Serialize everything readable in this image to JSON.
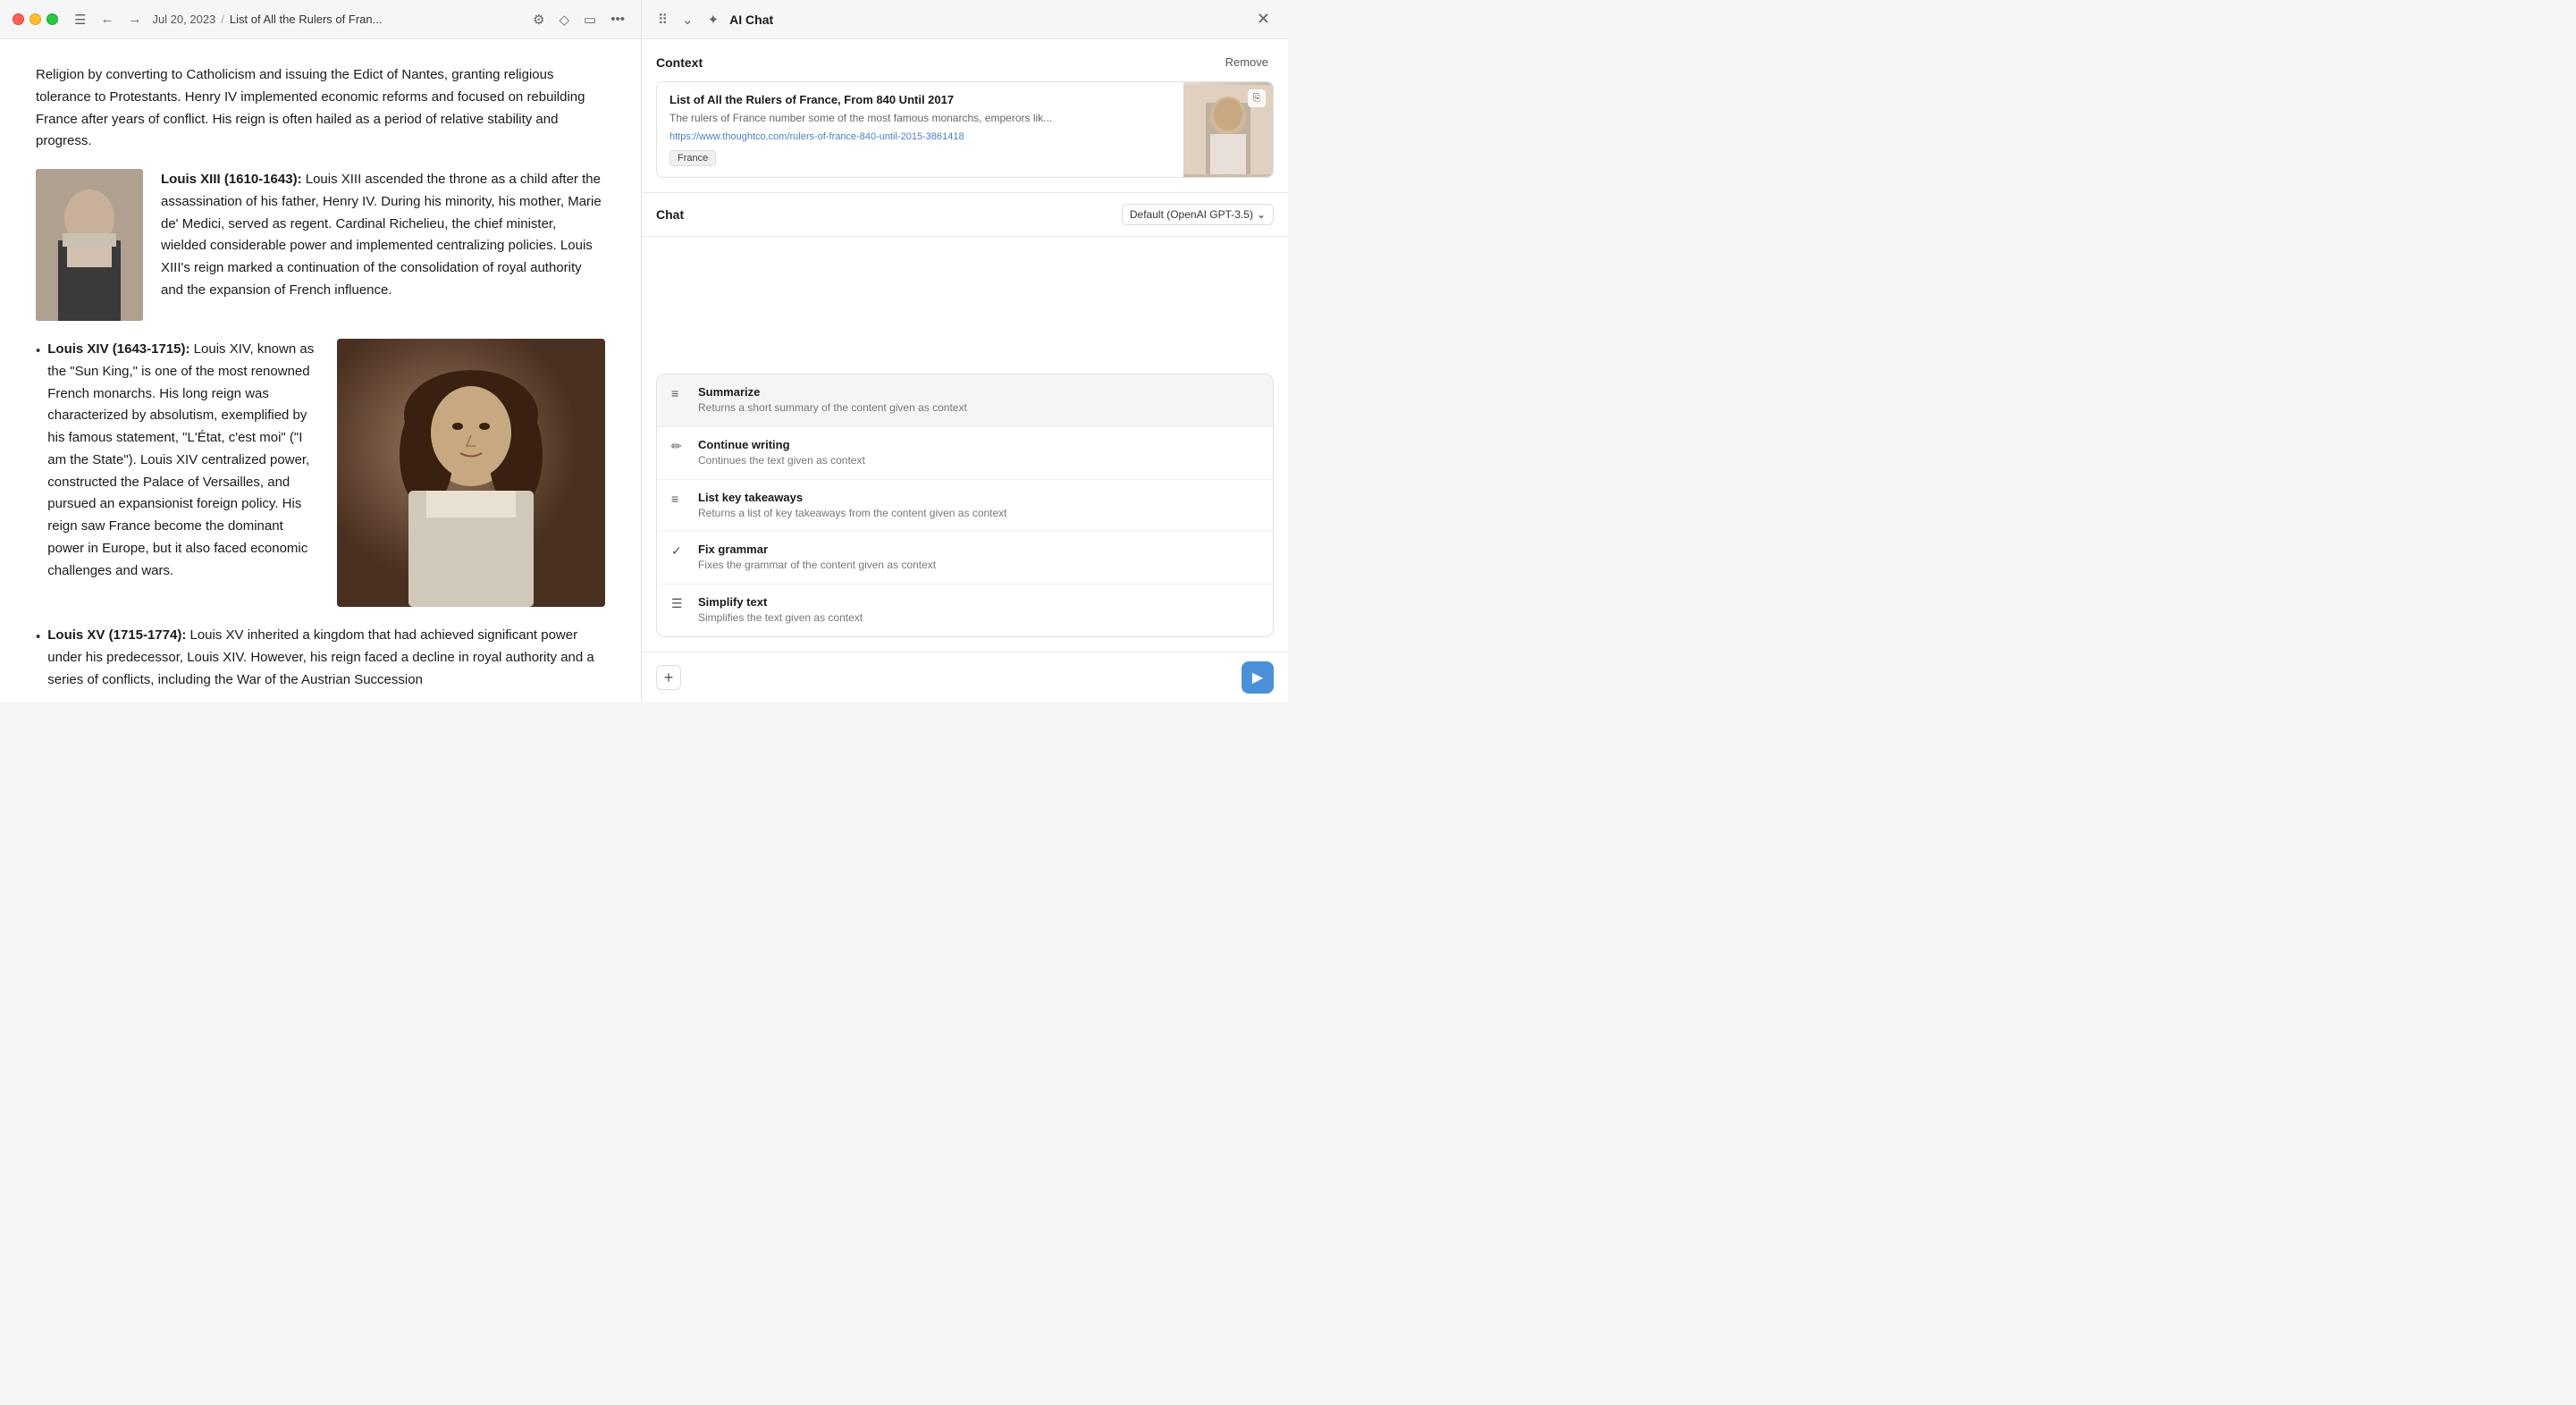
{
  "app": {
    "title": "List of All the Rulers of Fran..."
  },
  "toolbar": {
    "date": "Jul 20, 2023",
    "separator": "/",
    "page_title": "List of All the Rulers of Fran...",
    "nav_back": "←",
    "nav_forward": "→"
  },
  "content": {
    "intro_text": "Religion by converting to Catholicism and issuing the Edict of Nantes, granting religious tolerance to Protestants. Henry IV implemented economic reforms and focused on rebuilding France after years of conflict. His reign is often hailed as a period of relative stability and progress.",
    "louis13_title": "Louis XIII (1610-1643):",
    "louis13_text": "Louis XIII ascended the throne as a child after the assassination of his father, Henry IV. During his minority, his mother, Marie de' Medici, served as regent. Cardinal Richelieu, the chief minister, wielded considerable power and implemented centralizing policies. Louis XIII's reign marked a continuation of the consolidation of royal authority and the expansion of French influence.",
    "louis14_bullet": "Louis XIV (1643-1715):",
    "louis14_text": "Louis XIV, known as the \"Sun King,\" is one of the most renowned French monarchs. His long reign was characterized by absolutism, exemplified by his famous statement, \"L'État, c'est moi\" (\"I am the State\"). Louis XIV centralized power, constructed the Palace of Versailles, and pursued an expansionist foreign policy. His reign saw France become the dominant power in Europe, but it also faced economic challenges and wars.",
    "louis15_bullet": "Louis XV (1715-1774):",
    "louis15_text": "Louis XV inherited a kingdom that had achieved significant power under his predecessor, Louis XIV. However, his reign faced a decline in royal authority and a series of conflicts, including the War of the Austrian Succession"
  },
  "right_panel": {
    "title": "AI Chat",
    "close_label": "✕",
    "context_label": "Context",
    "remove_label": "Remove",
    "context_card": {
      "title": "List of All the Rulers of France, From 840 Until 2017",
      "description": "The rulers of France number some of the most famous monarchs, emperors lik...",
      "url": "https://www.thoughtco.com/rulers-of-france-840-until-2015-3861418",
      "tag": "France"
    },
    "chat_label": "Chat",
    "model_label": "Default (OpenAI GPT-3.5)",
    "commands": [
      {
        "icon": "≡",
        "title": "Summarize",
        "description": "Returns a short summary of the content given as context"
      },
      {
        "icon": "✏",
        "title": "Continue writing",
        "description": "Continues the text given as context"
      },
      {
        "icon": "≡",
        "title": "List key takeaways",
        "description": "Returns a list of key takeaways from the content given as context"
      },
      {
        "icon": "✓",
        "title": "Fix grammar",
        "description": "Fixes the grammar of the content given as context"
      },
      {
        "icon": "☰",
        "title": "Simplify text",
        "description": "Simplifies the text given as context"
      }
    ],
    "add_label": "+",
    "send_icon": "▶"
  }
}
